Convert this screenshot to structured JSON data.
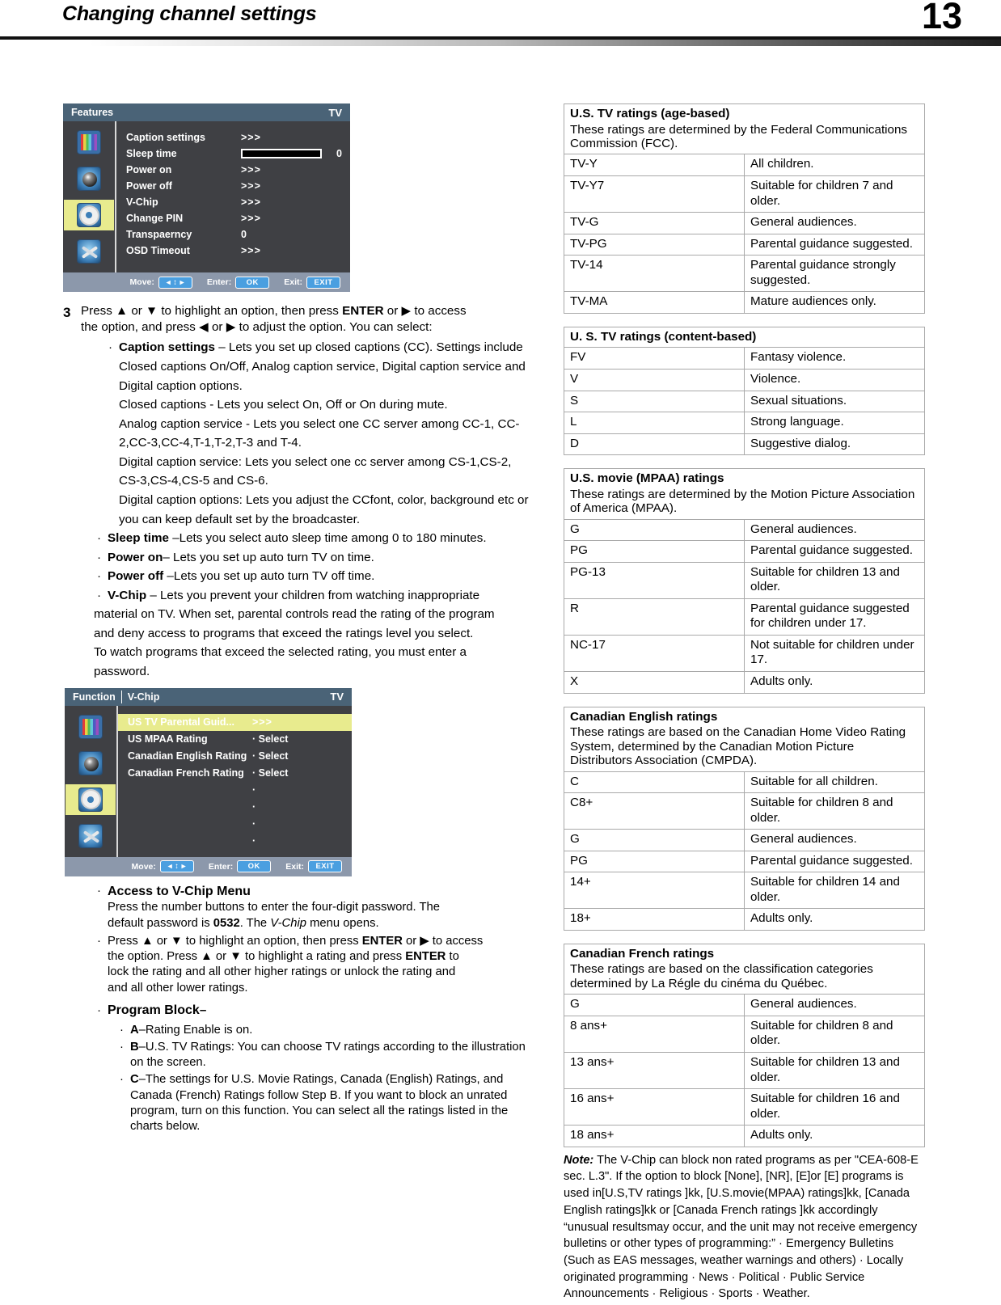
{
  "header": {
    "title": "Changing channel settings",
    "page_number": "13"
  },
  "osd_features": {
    "title": "Features",
    "source": "TV",
    "rows": [
      {
        "label": "Caption settings",
        "value": ">>>"
      },
      {
        "label": "Sleep time",
        "value": "slider",
        "number": "0"
      },
      {
        "label": "Power on",
        "value": ">>>"
      },
      {
        "label": "Power off",
        "value": ">>>"
      },
      {
        "label": "V-Chip",
        "value": ">>>"
      },
      {
        "label": "Change PIN",
        "value": ">>>"
      },
      {
        "label": "Transpaerncy",
        "value": "0"
      },
      {
        "label": "OSD Timeout",
        "value": ">>>"
      }
    ],
    "footer": {
      "move_label": "Move:",
      "move_btn": "◂ ↕ ▸",
      "enter_label": "Enter:",
      "enter_btn": "OK",
      "exit_label": "Exit:",
      "exit_btn": "EXIT"
    }
  },
  "osd_vchip": {
    "title_left": "Function",
    "title_right": "V-Chip",
    "source": "TV",
    "rows": [
      {
        "label": "US TV Parental Guid...",
        "value": ">>>",
        "highlighted": true
      },
      {
        "label": "US MPAA Rating",
        "value": "· Select"
      },
      {
        "label": "Canadian English Rating",
        "value": "· Select"
      },
      {
        "label": "Canadian French Rating",
        "value": "· Select"
      },
      {
        "label": "",
        "value": "·"
      },
      {
        "label": "",
        "value": "·"
      },
      {
        "label": "",
        "value": "·"
      },
      {
        "label": "",
        "value": "·"
      }
    ],
    "footer": {
      "move_label": "Move:",
      "move_btn": "◂ ↕ ▸",
      "enter_label": "Enter:",
      "enter_btn": "OK",
      "exit_label": "Exit:",
      "exit_btn": "EXIT"
    }
  },
  "step3": {
    "number": "3",
    "line1_a": "Press ",
    "line1_up": "▲",
    "line1_b": " or ",
    "line1_down": "▼",
    "line1_c": " to highlight an option, then press ",
    "line1_enter": "ENTER",
    "line1_d": " or ",
    "line1_right": "▶",
    "line1_e": " to access",
    "line2_a": "the option, and press ",
    "line2_left": "◀",
    "line2_b": " or ",
    "line2_right": "▶",
    "line2_c": " to adjust  the option. You can select:"
  },
  "bullets_main": [
    {
      "term": "Caption settings",
      "rest": " – Lets you set up closed captions (CC). Settings include Closed captions On/Off, Analog caption service, Digital caption service and Digital caption options."
    }
  ],
  "caption_detail_lines": [
    "Closed captions - Lets you select On, Off or On during mute.",
    "Analog caption service - Lets you select one CC server among CC-1, CC-2,CC-3,CC-4,T-1,T-2,T-3 and T-4.",
    "Digital caption service: Lets you select one cc server among CS-1,CS-2, CS-3,CS-4,CS-5 and CS-6.",
    "Digital caption options: Lets you adjust the CCfont, color, background etc or you can keep default set by the broadcaster."
  ],
  "bullets_options": [
    {
      "term": "Sleep time",
      "rest": " –Lets you select auto sleep time among 0 to 180 minutes."
    },
    {
      "term": "Power on",
      "rest": "– Lets you set up auto turn TV on time."
    },
    {
      "term": "Power off",
      "rest": " –Lets you set up auto turn TV off time."
    },
    {
      "term": "V-Chip",
      "rest": " – Lets you prevent your children from watching inappropriate"
    }
  ],
  "vchip_para": [
    "material on TV. When set, parental controls read the rating of the program",
    "and deny access to programs that exceed the ratings level you select.",
    "To watch programs that exceed the selected rating, you must enter a",
    " password."
  ],
  "access_section": {
    "heading": "Access to V-Chip Menu",
    "line1": "Press the number buttons to enter the four-digit password. The",
    "line2_a": "default password is ",
    "line2_pw": "0532",
    "line2_b": ". The ",
    "line2_ital": "V-Chip",
    "line2_c": " menu opens.",
    "press_a": "Press ",
    "press_up": "▲",
    "press_b": " or ",
    "press_down": "▼",
    "press_c": " to highlight an option, then press ",
    "press_enter": "ENTER",
    "press_d": " or ",
    "press_right": "▶",
    "press_e": " to access",
    "press_l2_a": "the option. Press ",
    "press_l2_b": " or ",
    "press_l2_c": " to highlight a rating and press  ",
    "press_l2_enter": "ENTER",
    "press_l2_d": "  to",
    "press_l3": "lock the rating and all other higher ratings or unlock the rating and",
    "press_l4": "and all other lower ratings."
  },
  "program_block": {
    "heading": "Program Block",
    "dash": "–",
    "items": [
      {
        "letter": "A",
        "text": "–Rating Enable is on."
      },
      {
        "letter": "B",
        "text": "–U.S. TV Ratings: You can choose TV ratings according to the illustration on the screen."
      },
      {
        "letter": "C",
        "text": "–The settings for U.S. Movie Ratings, Canada (English) Ratings, and Canada (French) Ratings follow Step B. If you want to block an unrated program, turn on this function. You can select all the ratings listed in the charts below."
      }
    ]
  },
  "tables": [
    {
      "title": "U.S. TV ratings (age-based)",
      "subtitle": "These ratings are determined by the Federal Communications Commission (FCC).",
      "rows": [
        {
          "code": "TV-Y",
          "desc": "All children."
        },
        {
          "code": "TV-Y7",
          "desc": "Suitable for children 7 and older."
        },
        {
          "code": "TV-G",
          "desc": "General audiences."
        },
        {
          "code": "TV-PG",
          "desc": "Parental guidance suggested."
        },
        {
          "code": "TV-14",
          "desc": "Parental guidance strongly suggested."
        },
        {
          "code": "TV-MA",
          "desc": "Mature audiences only."
        }
      ]
    },
    {
      "title": "U. S. TV ratings (content-based)",
      "subtitle": "",
      "rows": [
        {
          "code": "FV",
          "desc": "Fantasy violence."
        },
        {
          "code": "V",
          "desc": "Violence."
        },
        {
          "code": "S",
          "desc": "Sexual situations."
        },
        {
          "code": "L",
          "desc": "Strong language."
        },
        {
          "code": "D",
          "desc": "Suggestive dialog."
        }
      ]
    },
    {
      "title": "U.S. movie (MPAA) ratings",
      "subtitle": "These ratings are determined by the Motion Picture Association of America (MPAA).",
      "rows": [
        {
          "code": "G",
          "desc": "General audiences."
        },
        {
          "code": "PG",
          "desc": "Parental guidance suggested."
        },
        {
          "code": "PG-13",
          "desc": "Suitable for children 13 and older."
        },
        {
          "code": "R",
          "desc": "Parental guidance suggested for children under 17."
        },
        {
          "code": "NC-17",
          "desc": "Not suitable for children under 17."
        },
        {
          "code": "X",
          "desc": "Adults only."
        }
      ]
    },
    {
      "title": "Canadian English ratings",
      "subtitle": "These ratings are based on the Canadian Home Video Rating System, determined by the Canadian Motion Picture Distributors Association (CMPDA).",
      "rows": [
        {
          "code": "C",
          "desc": "Suitable for all children."
        },
        {
          "code": "C8+",
          "desc": "Suitable for children 8 and older."
        },
        {
          "code": "G",
          "desc": "General audiences."
        },
        {
          "code": "PG",
          "desc": "Parental guidance suggested."
        },
        {
          "code": "14+",
          "desc": "Suitable for children 14 and older."
        },
        {
          "code": "18+",
          "desc": "Adults only."
        }
      ]
    },
    {
      "title": "Canadian French ratings",
      "subtitle": "These ratings are based on the classification categories determined by La Régle du cinéma du Québec.",
      "rows": [
        {
          "code": "G",
          "desc": "General audiences."
        },
        {
          "code": "8 ans+",
          "desc": "Suitable for children 8 and older."
        },
        {
          "code": "13 ans+",
          "desc": "Suitable for children 13 and older."
        },
        {
          "code": "16 ans+",
          "desc": "Suitable for children 16 and older."
        },
        {
          "code": "18 ans+",
          "desc": "Adults only."
        }
      ]
    }
  ],
  "note": {
    "label": "Note:",
    "text": "  The V-Chip can block non rated programs as per \"CEA-608-E sec. L.3\". If the option to block [None], [NR], [E]or [E] programs is used in[U.S,TV ratings ]kk, [U.S.movie(MPAA) ratings]kk, [Canada English ratings]kk or [Canada French ratings ]kk accordingly “unusual resultsmay occur, and the unit may not receive emergency bulletins or other types of programming:” · Emergency Bulletins (Such as EAS messages, weather warnings and others) · Locally originated programming · News · Political · Public Service Announcements · Religious · Sports · Weather."
  },
  "colors": {
    "osd_bg": "#3f4044",
    "osd_title_bg": "#4a6377",
    "osd_footer_bg": "#8c98ab",
    "highlight": "#e8eb8e",
    "button_blue": "#4a9fe0"
  }
}
